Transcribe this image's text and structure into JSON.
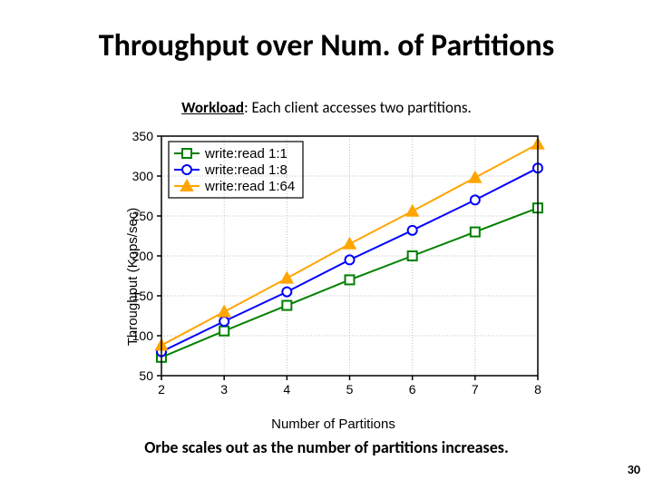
{
  "title": "Throughput over Num. of Partitions",
  "subtitle": {
    "lead": "Workload",
    "rest": ": Each client accesses two partitions."
  },
  "caption": "Orbe scales out as the number of partitions increases.",
  "page_number": "30",
  "chart_data": {
    "type": "line",
    "title": "",
    "xlabel": "Number of Partitions",
    "ylabel": "Throughput (Kops/sec)",
    "xlim": [
      2,
      8
    ],
    "ylim": [
      50,
      350
    ],
    "xticks": [
      2,
      3,
      4,
      5,
      6,
      7,
      8
    ],
    "yticks": [
      50,
      100,
      150,
      200,
      250,
      300,
      350
    ],
    "grid": true,
    "legend_position": "top-left",
    "legend_entries": [
      "write:read 1:1",
      "write:read 1:8",
      "write:read 1:64"
    ],
    "series": [
      {
        "name": "write:read 1:1",
        "color": "#008000",
        "marker": "square",
        "x": [
          2,
          3,
          4,
          5,
          6,
          7,
          8
        ],
        "y": [
          73,
          106,
          138,
          170,
          200,
          230,
          260
        ]
      },
      {
        "name": "write:read 1:8",
        "color": "#0000ff",
        "marker": "circle",
        "x": [
          2,
          3,
          4,
          5,
          6,
          7,
          8
        ],
        "y": [
          80,
          118,
          155,
          195,
          232,
          270,
          310
        ]
      },
      {
        "name": "write:read 1:64",
        "color": "#ffa500",
        "marker": "triangle",
        "x": [
          2,
          3,
          4,
          5,
          6,
          7,
          8
        ],
        "y": [
          88,
          130,
          172,
          215,
          256,
          298,
          340
        ]
      }
    ]
  }
}
